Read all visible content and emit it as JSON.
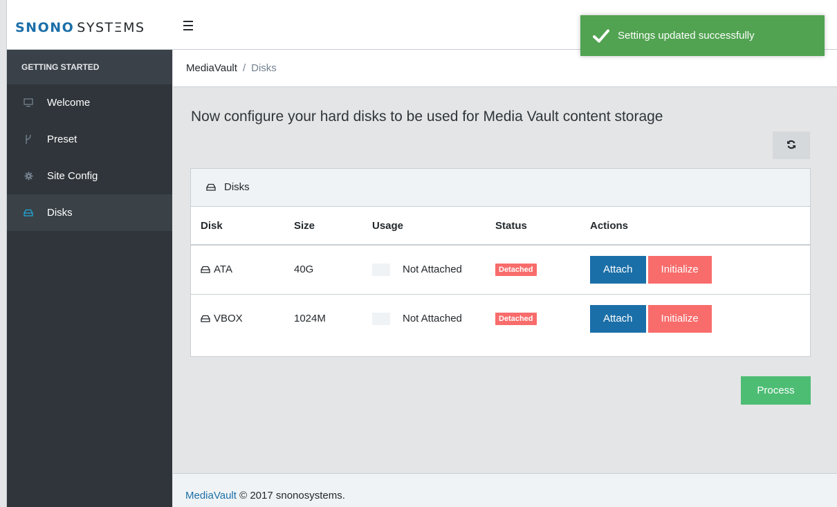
{
  "brand": {
    "part1": "SNONO",
    "part2": "SYSTΞMS"
  },
  "sidebar": {
    "section_title": "GETTING STARTED",
    "items": [
      {
        "label": "Welcome",
        "icon": "monitor-icon",
        "active": false
      },
      {
        "label": "Preset",
        "icon": "fork-icon",
        "active": false
      },
      {
        "label": "Site Config",
        "icon": "gear-icon",
        "active": false
      },
      {
        "label": "Disks",
        "icon": "hdd-icon",
        "active": true
      }
    ]
  },
  "breadcrumb": {
    "root": "MediaVault",
    "separator": "/",
    "current": "Disks"
  },
  "main": {
    "heading": "Now configure your hard disks to be used for Media Vault content storage",
    "refresh_icon": "refresh-icon"
  },
  "disks_card": {
    "title": "Disks",
    "columns": [
      "Disk",
      "Size",
      "Usage",
      "Status",
      "Actions"
    ],
    "rows": [
      {
        "disk": "ATA",
        "size": "40G",
        "usage": "Not Attached",
        "status": "Detached",
        "attach_label": "Attach",
        "initialize_label": "Initialize"
      },
      {
        "disk": "VBOX",
        "size": "1024M",
        "usage": "Not Attached",
        "status": "Detached",
        "attach_label": "Attach",
        "initialize_label": "Initialize"
      }
    ]
  },
  "process_label": "Process",
  "footer": {
    "link": "MediaVault",
    "text": "© 2017 snonosystems."
  },
  "toast": {
    "message": "Settings updated successfully",
    "icon": "check-icon"
  },
  "colors": {
    "brand_blue": "#1b6fa8",
    "sidebar_bg": "#2f353a",
    "danger": "#f86c6b",
    "success": "#4dbd74",
    "toast_green": "#51a351"
  }
}
